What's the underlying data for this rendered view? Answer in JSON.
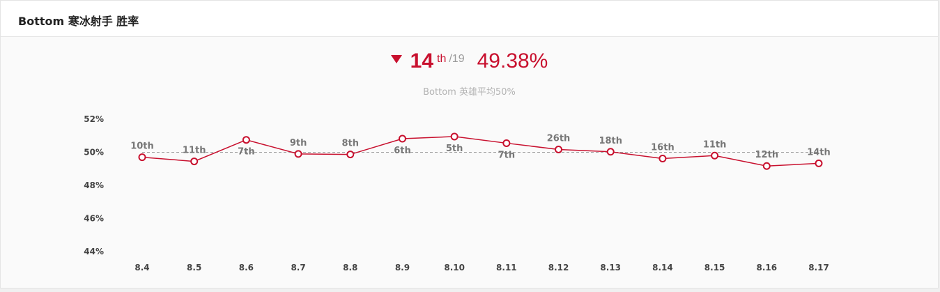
{
  "header": {
    "title": "Bottom 寒冰射手 胜率"
  },
  "summary": {
    "rank": "14",
    "rank_suffix": "th",
    "rank_total": "/19",
    "win_rate": "49.38%",
    "subtitle": "Bottom 英雄平均50%",
    "trend_icon": "triangle-down-icon"
  },
  "colors": {
    "accent": "#c8102e",
    "reference_line": "#999999"
  },
  "chart_data": {
    "type": "line",
    "x": [
      "8.4",
      "8.5",
      "8.6",
      "8.7",
      "8.8",
      "8.9",
      "8.10",
      "8.11",
      "8.12",
      "8.13",
      "8.14",
      "8.15",
      "8.16",
      "8.17"
    ],
    "series": [
      {
        "values": [
          49.7,
          49.45,
          50.75,
          49.9,
          49.87,
          50.82,
          50.95,
          50.55,
          50.17,
          50.03,
          49.62,
          49.8,
          49.17,
          49.33
        ],
        "labels": [
          "10th",
          "11th",
          "7th",
          "9th",
          "8th",
          "6th",
          "5th",
          "7th",
          "26th",
          "18th",
          "16th",
          "11th",
          "12th",
          "14th"
        ]
      }
    ],
    "reference_value": 50,
    "ylim": [
      44,
      52
    ],
    "yticks": [
      "52%",
      "50%",
      "48%",
      "46%",
      "44%"
    ],
    "ytick_values": [
      52,
      50,
      48,
      46,
      44
    ],
    "grid": false,
    "legend": "none"
  }
}
